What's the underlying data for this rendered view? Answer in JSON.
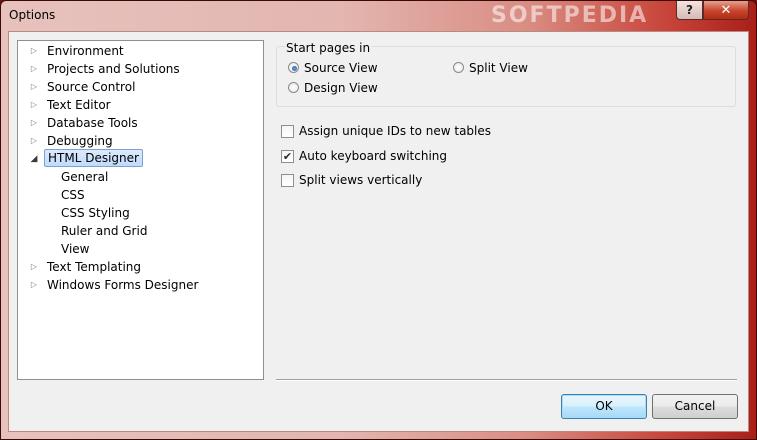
{
  "window": {
    "title": "Options",
    "help_glyph": "?",
    "close_glyph": "✕",
    "watermark": "SOFTPEDIA"
  },
  "tree": {
    "items": [
      {
        "label": "Environment",
        "expanded": false
      },
      {
        "label": "Projects and Solutions",
        "expanded": false
      },
      {
        "label": "Source Control",
        "expanded": false
      },
      {
        "label": "Text Editor",
        "expanded": false
      },
      {
        "label": "Database Tools",
        "expanded": false
      },
      {
        "label": "Debugging",
        "expanded": false
      },
      {
        "label": "HTML Designer",
        "expanded": true,
        "selected": true,
        "children": [
          "General",
          "CSS",
          "CSS Styling",
          "Ruler and Grid",
          "View"
        ]
      },
      {
        "label": "Text Templating",
        "expanded": false
      },
      {
        "label": "Windows Forms Designer",
        "expanded": false
      }
    ]
  },
  "start_pages": {
    "title": "Start pages in",
    "options": [
      {
        "label": "Source View",
        "checked": true
      },
      {
        "label": "Split View",
        "checked": false
      },
      {
        "label": "Design View",
        "checked": false
      }
    ]
  },
  "checkboxes": [
    {
      "label": "Assign unique IDs to new tables",
      "checked": false
    },
    {
      "label": "Auto keyboard switching",
      "checked": true
    },
    {
      "label": "Split views vertically",
      "checked": false
    }
  ],
  "buttons": {
    "ok": "OK",
    "cancel": "Cancel"
  },
  "colors": {
    "selection": "#c1dbfc",
    "titlebar_accent": "#a81f18"
  }
}
